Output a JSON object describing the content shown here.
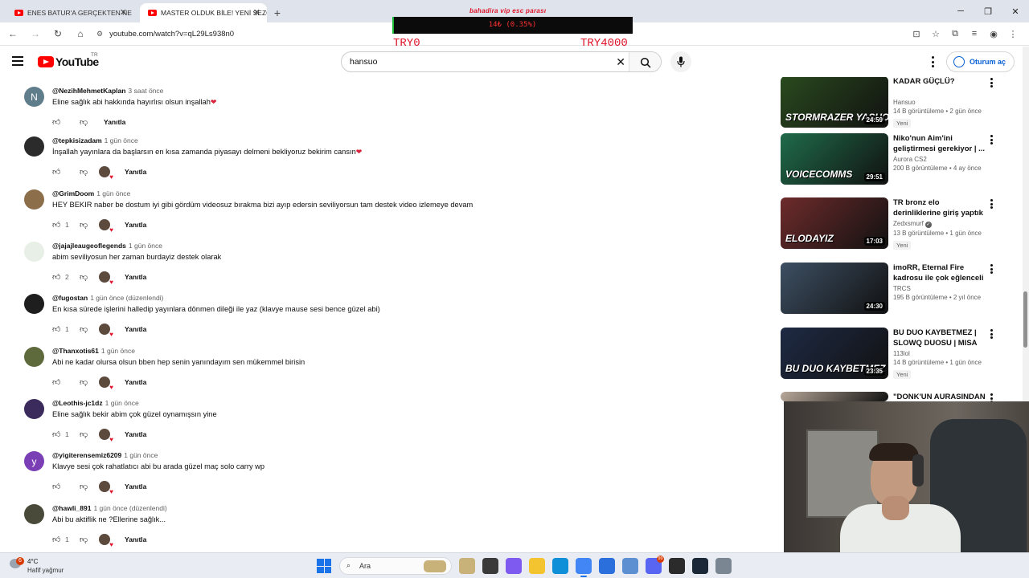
{
  "browser": {
    "tabs": [
      {
        "label": "ENES BATUR'A GERÇEKTEN NE OLDU",
        "active": false
      },
      {
        "label": "MASTER OLDUK BİLE! YENİ SEZON",
        "active": true
      }
    ],
    "url": "youtube.com/watch?v=qL29Ls938n0"
  },
  "overlay": {
    "title": "bahadira vip esc parası",
    "progress_label": "14₺ (0.35%)",
    "progress_fraction": 0.0035,
    "min_label": "TRY0",
    "max_label": "TRY4000"
  },
  "youtube": {
    "logo_text": "YouTube",
    "country": "TR",
    "search_query": "hansuo",
    "signin_label": "Oturum aç"
  },
  "comments": [
    {
      "author": "@NezihMehmetKaplan",
      "time": "3 saat önce",
      "text": "Eline sağlık abi hakkında hayırlısı olsun inşallah",
      "heart_emoji": true,
      "likes": "",
      "creator_heart": false,
      "reply": "Yanıtla",
      "avatar_letter": "N",
      "avatar_color": "#607d8b"
    },
    {
      "author": "@tepkisizadam",
      "time": "1 gün önce",
      "text": "İnşallah yayınlara da başlarsın en kısa zamanda piyasayı delmeni bekliyoruz bekirim cansın",
      "heart_emoji": true,
      "likes": "",
      "creator_heart": true,
      "reply": "Yanıtla",
      "avatar_letter": "",
      "avatar_color": "#2b2b2b"
    },
    {
      "author": "@GrimDoom",
      "time": "1 gün önce",
      "text": "HEY BEKIR naber be dostum iyi gibi gördüm videosuz bırakma bizi ayıp edersin seviliyorsun tam destek video izlemeye devam",
      "heart_emoji": false,
      "likes": "1",
      "creator_heart": true,
      "reply": "Yanıtla",
      "avatar_letter": "",
      "avatar_color": "#8d6e4a"
    },
    {
      "author": "@jajajleaugeoflegends",
      "time": "1 gün önce",
      "text": "abim seviliyosun her zaman burdayiz destek olarak",
      "heart_emoji": false,
      "likes": "2",
      "creator_heart": true,
      "reply": "Yanıtla",
      "avatar_letter": "",
      "avatar_color": "#e8efe6"
    },
    {
      "author": "@fugostan",
      "time": "1 gün önce (düzenlendi)",
      "text": "En kısa sürede işlerini halledip yayınlara dönmen dileği ile yaz (klavye mause sesi bence güzel abi)",
      "heart_emoji": false,
      "likes": "1",
      "creator_heart": true,
      "reply": "Yanıtla",
      "avatar_letter": "",
      "avatar_color": "#1e1e1e"
    },
    {
      "author": "@Thanxotis61",
      "time": "1 gün önce",
      "text": "Abi  ne kadar olursa olsun bben hep senin yanındayım sen mükemmel birisin",
      "heart_emoji": false,
      "likes": "",
      "creator_heart": true,
      "reply": "Yanıtla",
      "avatar_letter": "",
      "avatar_color": "#5e6a3b"
    },
    {
      "author": "@Leothis-jc1dz",
      "time": "1 gün önce",
      "text": "Eline sağlık bekir abim çok güzel oynamışsın yine",
      "heart_emoji": false,
      "likes": "1",
      "creator_heart": true,
      "reply": "Yanıtla",
      "avatar_letter": "",
      "avatar_color": "#3b2a5c"
    },
    {
      "author": "@yigiterensemiz6209",
      "time": "1 gün önce",
      "text": "Klavye sesi çok rahatlatıcı abi bu arada güzel maç solo carry wp",
      "heart_emoji": false,
      "likes": "",
      "creator_heart": true,
      "reply": "Yanıtla",
      "avatar_letter": "y",
      "avatar_color": "#7b3fb5"
    },
    {
      "author": "@hawli_891",
      "time": "1 gün önce (düzenlendi)",
      "text": "Abi bu aktiflik ne ?Ellerine sağlık...",
      "heart_emoji": false,
      "likes": "1",
      "creator_heart": true,
      "reply": "Yanıtla",
      "avatar_letter": "",
      "avatar_color": "#4a4a3a"
    }
  ],
  "sidebar": [
    {
      "title": "KADAR GÜÇLÜ?",
      "channel": "Hansuo",
      "verified": false,
      "meta": "14 B görüntüleme • 2 gün önce",
      "badge": "Yeni",
      "duration": "24:59",
      "caption": "STORMRAZER YASUO OYNANIŞ",
      "thumb_color": "#2a4a1e"
    },
    {
      "title": "Niko'nun Aim'ini geliştirmesi gerekiyor | ...",
      "channel": "Aurora CS2",
      "verified": false,
      "meta": "200 B görüntüleme • 4 ay önce",
      "badge": "",
      "duration": "29:51",
      "caption": "VOICECOMMS",
      "thumb_color": "#1f6b4a"
    },
    {
      "title": "TR bronz elo derinliklerine giriş yaptık",
      "channel": "Zedxsmurf",
      "verified": true,
      "meta": "13 B görüntüleme • 1 gün önce",
      "badge": "Yeni",
      "duration": "17:03",
      "caption": "ELODAYIZ",
      "thumb_color": "#6e2b2b"
    },
    {
      "title": "imoRR, Eternal Fire kadrosu ile çok eğlenceli ...",
      "channel": "TRCS",
      "verified": false,
      "meta": "195 B görüntüleme • 2 yıl önce",
      "badge": "",
      "duration": "24:30",
      "caption": "",
      "thumb_color": "#3d4f63"
    },
    {
      "title": "BU DUO KAYBETMEZ | SLOWQ DUOSU | MISA 1...",
      "channel": "113lol",
      "verified": false,
      "meta": "14 B görüntüleme • 1 gün önce",
      "badge": "Yeni",
      "duration": "23:35",
      "caption": "BU DUO KAYBETMEZ",
      "thumb_color": "#1e2a44"
    },
    {
      "title": "\"DONK'UN AURASINDAN",
      "channel": "",
      "verified": false,
      "meta": "",
      "badge": "",
      "duration": "",
      "caption": "",
      "thumb_color": "#b8a89a"
    }
  ],
  "taskbar": {
    "weather_badge": "6",
    "temperature": "4°C",
    "weather_desc": "Hafif yağmur",
    "search_label": "Ara",
    "apps": [
      {
        "name": "widgets",
        "color": "#c9b27a"
      },
      {
        "name": "terminal",
        "color": "#3a3a3a"
      },
      {
        "name": "copilot",
        "color": "#7f5af0"
      },
      {
        "name": "file-explorer",
        "color": "#f4c430"
      },
      {
        "name": "edge",
        "color": "#0f8fd8"
      },
      {
        "name": "chrome",
        "color": "#4285f4",
        "active": true
      },
      {
        "name": "store",
        "color": "#2a6fdb"
      },
      {
        "name": "settings-gear",
        "color": "#5b8fd1"
      },
      {
        "name": "discord",
        "color": "#5865f2",
        "badge": "99"
      },
      {
        "name": "obs",
        "color": "#2b2b2b"
      },
      {
        "name": "steam",
        "color": "#1b2838"
      },
      {
        "name": "settings",
        "color": "#7a8793"
      }
    ]
  }
}
